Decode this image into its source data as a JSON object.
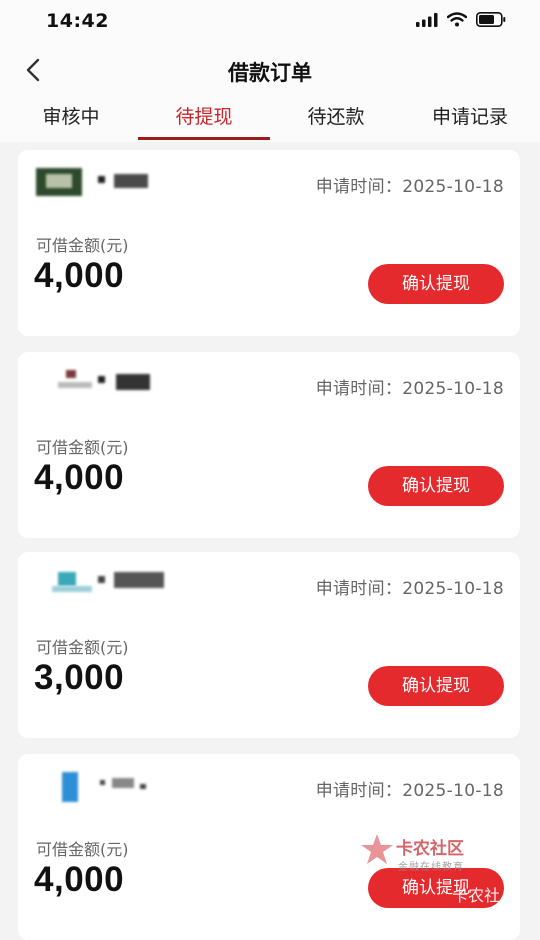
{
  "status_bar": {
    "time": "14:42"
  },
  "header": {
    "title": "借款订单"
  },
  "tabs": [
    {
      "label": "审核中",
      "active": false
    },
    {
      "label": "待提现",
      "active": true
    },
    {
      "label": "待还款",
      "active": false
    },
    {
      "label": "申请记录",
      "active": false
    }
  ],
  "orders": [
    {
      "apply_time": "申请时间：2025-10-18",
      "amount_label": "可借金额(元)",
      "amount": "4,000",
      "button": "确认提现"
    },
    {
      "apply_time": "申请时间：2025-10-18",
      "amount_label": "可借金额(元)",
      "amount": "4,000",
      "button": "确认提现"
    },
    {
      "apply_time": "申请时间：2025-10-18",
      "amount_label": "可借金额(元)",
      "amount": "3,000",
      "button": "确认提现"
    },
    {
      "apply_time": "申请时间：2025-10-18",
      "amount_label": "可借金额(元)",
      "amount": "4,000",
      "button": "确认提现"
    }
  ],
  "watermark": {
    "name": "卡农社区",
    "tagline": "金融在线教育",
    "tail": "卡农社"
  },
  "colors": {
    "accent": "#e52a2e",
    "active_tab": "#c8262a",
    "underline": "#9b1c1e"
  },
  "icons": [
    "signal-icon",
    "wifi-icon",
    "battery-icon",
    "back-arrow-icon"
  ]
}
